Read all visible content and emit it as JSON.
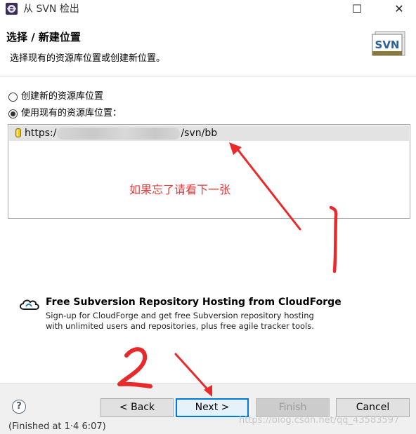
{
  "window": {
    "title": "从 SVN 检出",
    "maximize_glyph": "☐",
    "close_glyph": "✕"
  },
  "header": {
    "title": "选择 / 新建位置",
    "description": "选择现有的资源库位置或创建新位置。",
    "logo_text": "SVN"
  },
  "options": {
    "create_new": "创建新的资源库位置",
    "use_existing": "使用现有的资源库位置：",
    "selected": "use_existing"
  },
  "repositories": {
    "items": [
      {
        "url_prefix": "https:/",
        "url_suffix": "/svn/bb"
      }
    ]
  },
  "annotation": {
    "note": "如果忘了请看下一张"
  },
  "cloudforge": {
    "title": "Free Subversion Repository Hosting from CloudForge",
    "line1": "Sign-up for CloudForge and get free Subversion repository hosting",
    "line2": "with unlimited users and repositories, plus free agile tracker tools."
  },
  "footer": {
    "help": "?",
    "back": "< Back",
    "next": "Next >",
    "finish": "Finish",
    "cancel": "Cancel"
  },
  "status_fragment": "(Finished at 1·4 6:07)",
  "watermark": "https://blog.csdn.net/qq_43583597",
  "colors": {
    "annotation": "#e83a3a",
    "focus": "#0078d7"
  }
}
